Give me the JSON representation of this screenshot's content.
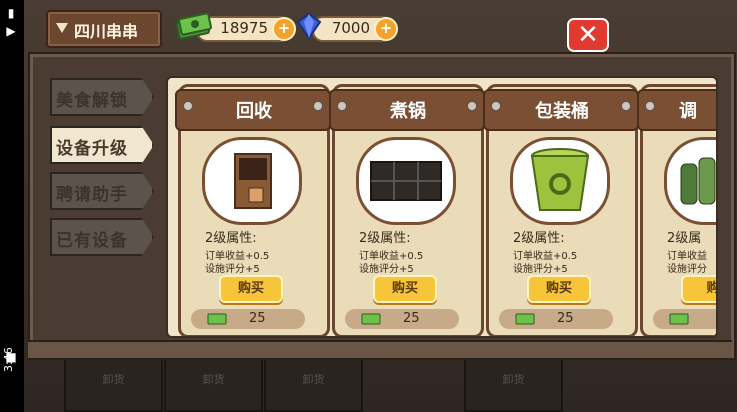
{
  "status": {
    "time": "3:46"
  },
  "header": {
    "shop_name": "四川串串",
    "cash": "18975",
    "gems": "7000",
    "close_label": "✕"
  },
  "tabs": [
    {
      "label": "美食解锁",
      "active": false
    },
    {
      "label": "设备升级",
      "active": true
    },
    {
      "label": "聘请助手",
      "active": false
    },
    {
      "label": "已有设备",
      "active": false
    }
  ],
  "cards": [
    {
      "title": "回收",
      "level": "2级属性:",
      "line1": "订单收益+0.5",
      "line2": "设施评分+5",
      "buy": "购买",
      "price": "25",
      "icon": "recycle-bin-icon"
    },
    {
      "title": "煮锅",
      "level": "2级属性:",
      "line1": "订单收益+0.5",
      "line2": "设施评分+5",
      "buy": "购买",
      "price": "25",
      "icon": "cooking-pot-icon"
    },
    {
      "title": "包装桶",
      "level": "2级属性:",
      "line1": "订单收益+0.5",
      "line2": "设施评分+5",
      "buy": "购买",
      "price": "25",
      "icon": "packaging-bucket-icon"
    },
    {
      "title": "调",
      "level": "2级属",
      "line1": "订单收益",
      "line2": "设施评分",
      "buy": "购",
      "price": "",
      "icon": "seasoning-bottles-icon"
    }
  ],
  "background": {
    "counter_labels": [
      "卸货",
      "卸货",
      "卸货",
      "卸货"
    ]
  },
  "colors": {
    "accent_gold": "#f7c53a",
    "close_red": "#e13b2f",
    "wood": "#7a4f33"
  }
}
